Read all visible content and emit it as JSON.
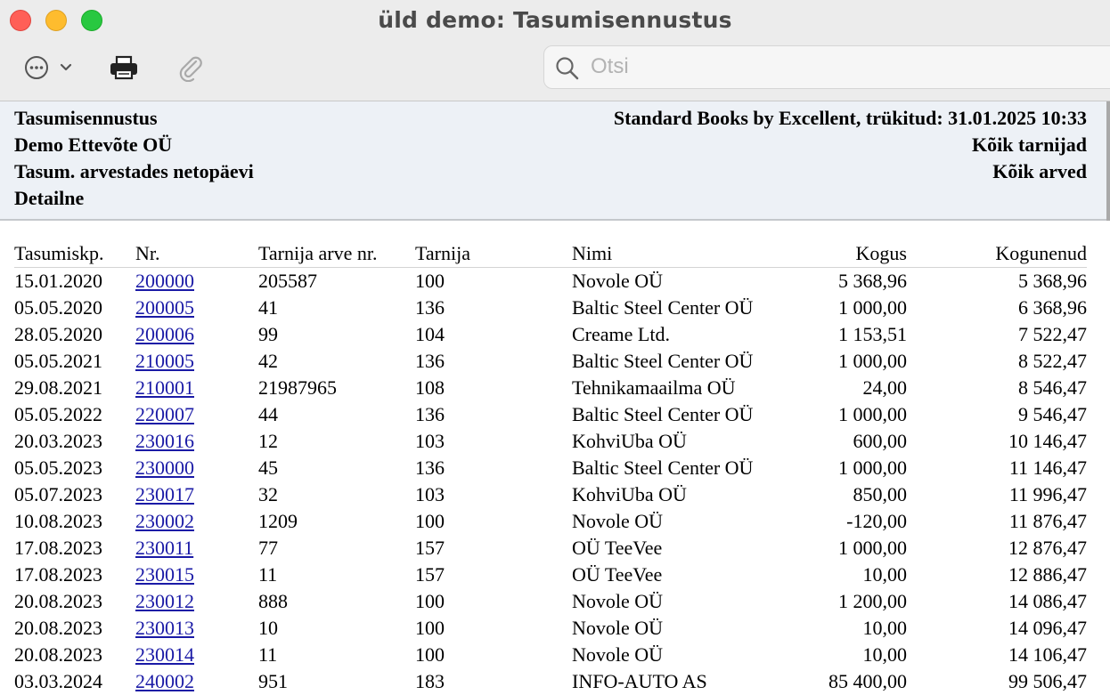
{
  "window": {
    "title": "üld demo: Tasumisennustus"
  },
  "toolbar": {
    "more_icon": "ellipsis-circle-icon",
    "print_icon": "printer-icon",
    "attach_icon": "paperclip-icon"
  },
  "search": {
    "placeholder": "Otsi"
  },
  "report": {
    "left": [
      "Tasumisennustus",
      "Demo Ettevõte OÜ",
      "Tasum. arvestades netopäevi",
      "Detailne"
    ],
    "right": [
      "Standard Books by Excellent, trükitud: 31.01.2025 10:33",
      "Kõik tarnijad",
      "Kõik arved"
    ]
  },
  "table": {
    "columns": [
      "Tasumiskp.",
      "Nr.",
      "Tarnija arve nr.",
      "Tarnija",
      "Nimi",
      "Kogus",
      "Kogunenud"
    ],
    "rows": [
      {
        "date": "15.01.2020",
        "nr": "200000",
        "inv": "205587",
        "supplier": "100",
        "name": "Novole OÜ",
        "amount": "5 368,96",
        "total": "5 368,96"
      },
      {
        "date": "05.05.2020",
        "nr": "200005",
        "inv": "41",
        "supplier": "136",
        "name": "Baltic Steel Center OÜ",
        "amount": "1 000,00",
        "total": "6 368,96"
      },
      {
        "date": "28.05.2020",
        "nr": "200006",
        "inv": "99",
        "supplier": "104",
        "name": "Creame Ltd.",
        "amount": "1 153,51",
        "total": "7 522,47"
      },
      {
        "date": "05.05.2021",
        "nr": "210005",
        "inv": "42",
        "supplier": "136",
        "name": "Baltic Steel Center OÜ",
        "amount": "1 000,00",
        "total": "8 522,47"
      },
      {
        "date": "29.08.2021",
        "nr": "210001",
        "inv": "21987965",
        "supplier": "108",
        "name": "Tehnikamaailma OÜ",
        "amount": "24,00",
        "total": "8 546,47"
      },
      {
        "date": "05.05.2022",
        "nr": "220007",
        "inv": "44",
        "supplier": "136",
        "name": "Baltic Steel Center OÜ",
        "amount": "1 000,00",
        "total": "9 546,47"
      },
      {
        "date": "20.03.2023",
        "nr": "230016",
        "inv": "12",
        "supplier": "103",
        "name": "KohviUba OÜ",
        "amount": "600,00",
        "total": "10 146,47"
      },
      {
        "date": "05.05.2023",
        "nr": "230000",
        "inv": "45",
        "supplier": "136",
        "name": "Baltic Steel Center OÜ",
        "amount": "1 000,00",
        "total": "11 146,47"
      },
      {
        "date": "05.07.2023",
        "nr": "230017",
        "inv": "32",
        "supplier": "103",
        "name": "KohviUba OÜ",
        "amount": "850,00",
        "total": "11 996,47"
      },
      {
        "date": "10.08.2023",
        "nr": "230002",
        "inv": "1209",
        "supplier": "100",
        "name": "Novole OÜ",
        "amount": "-120,00",
        "total": "11 876,47"
      },
      {
        "date": "17.08.2023",
        "nr": "230011",
        "inv": "77",
        "supplier": "157",
        "name": "OÜ TeeVee",
        "amount": "1 000,00",
        "total": "12 876,47"
      },
      {
        "date": "17.08.2023",
        "nr": "230015",
        "inv": "11",
        "supplier": "157",
        "name": "OÜ TeeVee",
        "amount": "10,00",
        "total": "12 886,47"
      },
      {
        "date": "20.08.2023",
        "nr": "230012",
        "inv": "888",
        "supplier": "100",
        "name": "Novole OÜ",
        "amount": "1 200,00",
        "total": "14 086,47"
      },
      {
        "date": "20.08.2023",
        "nr": "230013",
        "inv": "10",
        "supplier": "100",
        "name": "Novole OÜ",
        "amount": "10,00",
        "total": "14 096,47"
      },
      {
        "date": "20.08.2023",
        "nr": "230014",
        "inv": "11",
        "supplier": "100",
        "name": "Novole OÜ",
        "amount": "10,00",
        "total": "14 106,47"
      },
      {
        "date": "03.03.2024",
        "nr": "240002",
        "inv": "951",
        "supplier": "183",
        "name": "INFO-AUTO AS",
        "amount": "85 400,00",
        "total": "99 506,47"
      }
    ]
  }
}
